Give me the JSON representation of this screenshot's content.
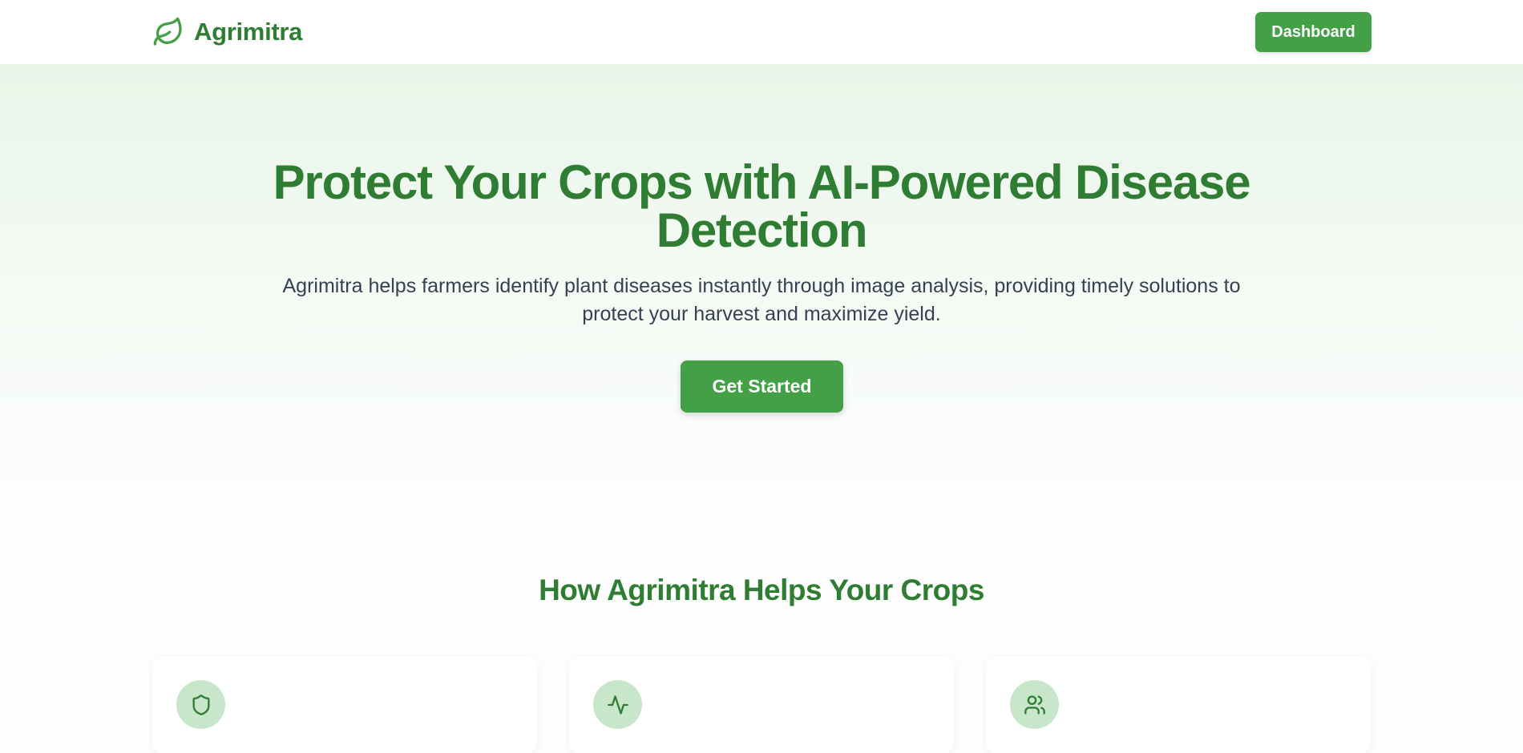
{
  "navbar": {
    "brand_name": "Agrimitra",
    "brand_icon": "leaf-icon",
    "dashboard_label": "Dashboard"
  },
  "hero": {
    "title": "Protect Your Crops with AI-Powered Disease Detection",
    "subtitle": "Agrimitra helps farmers identify plant diseases instantly through image analysis, providing timely solutions to protect your harvest and maximize yield.",
    "cta_label": "Get Started"
  },
  "features": {
    "title": "How Agrimitra Helps Your Crops",
    "cards": [
      {
        "icon": "shield-icon"
      },
      {
        "icon": "activity-icon"
      },
      {
        "icon": "users-icon"
      }
    ]
  },
  "colors": {
    "brand_green": "#2e7d32",
    "button_green": "#43a047",
    "icon_circle": "#c8e6c9",
    "hero_gradient_top": "#e8f5e9",
    "body_text": "#374151"
  }
}
